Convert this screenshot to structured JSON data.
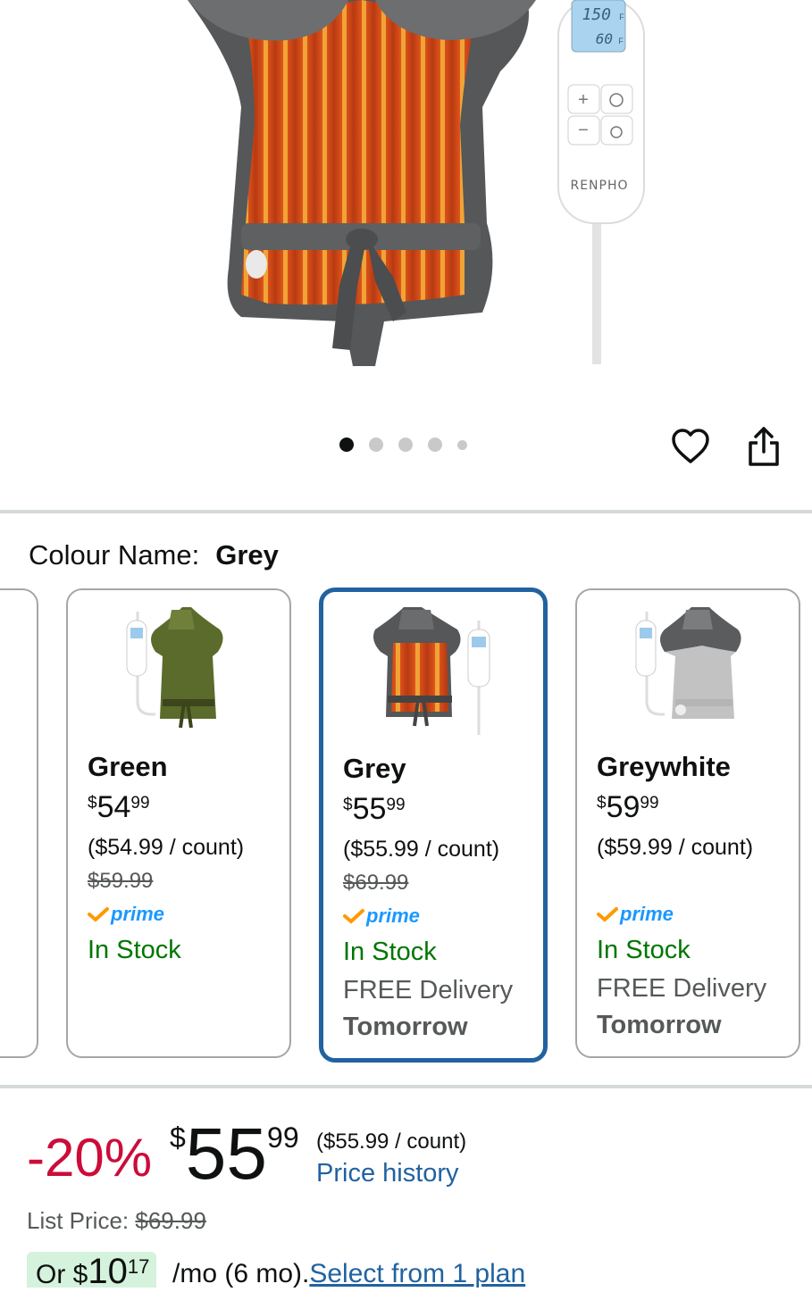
{
  "hero": {
    "remote_brand": "RENPHO",
    "remote_display_temp": "150",
    "remote_display_unit": "F",
    "remote_display_time": "60",
    "remote_display_time_unit": "m",
    "carousel_total": 5,
    "carousel_active": 1
  },
  "colour": {
    "label": "Colour Name:",
    "value": "Grey"
  },
  "variants": [
    {
      "name": "Green",
      "price_currency": "$",
      "price_whole": "54",
      "price_fraction": "99",
      "unit_price": "($54.99 / count)",
      "list_price": "$59.99",
      "prime": "prime",
      "stock": "In Stock",
      "delivery": "",
      "delivery_day": "",
      "swatch_color": "#5b6b2c"
    },
    {
      "name": "Grey",
      "price_currency": "$",
      "price_whole": "55",
      "price_fraction": "99",
      "unit_price": "($55.99 / count)",
      "list_price": "$69.99",
      "prime": "prime",
      "stock": "In Stock",
      "delivery": "FREE Delivery",
      "delivery_day": "Tomorrow",
      "swatch_color": "#5a5a5a",
      "selected": true
    },
    {
      "name": "Greywhite",
      "price_currency": "$",
      "price_whole": "59",
      "price_fraction": "99",
      "unit_price": "($59.99 / count)",
      "list_price": "",
      "prime": "prime",
      "stock": "In Stock",
      "delivery": "FREE Delivery",
      "delivery_day": "Tomorrow",
      "swatch_color": "#c2c2c2"
    }
  ],
  "price": {
    "discount": "-20%",
    "currency": "$",
    "whole": "55",
    "fraction": "99",
    "unit_price": "($55.99 / count)",
    "history_link": "Price history",
    "list_label": "List Price:",
    "list_value": "$69.99"
  },
  "emi": {
    "prefix": "Or $",
    "whole": "10",
    "fraction": "17",
    "suffix": "/mo (6 mo).",
    "link": "Select from 1 plan"
  },
  "colors": {
    "accent_blue": "#2162a1",
    "discount_red": "#cc0c39",
    "stock_green": "#007600",
    "prime_blue": "#1a98ff",
    "emi_bg": "#d4f2dc"
  }
}
